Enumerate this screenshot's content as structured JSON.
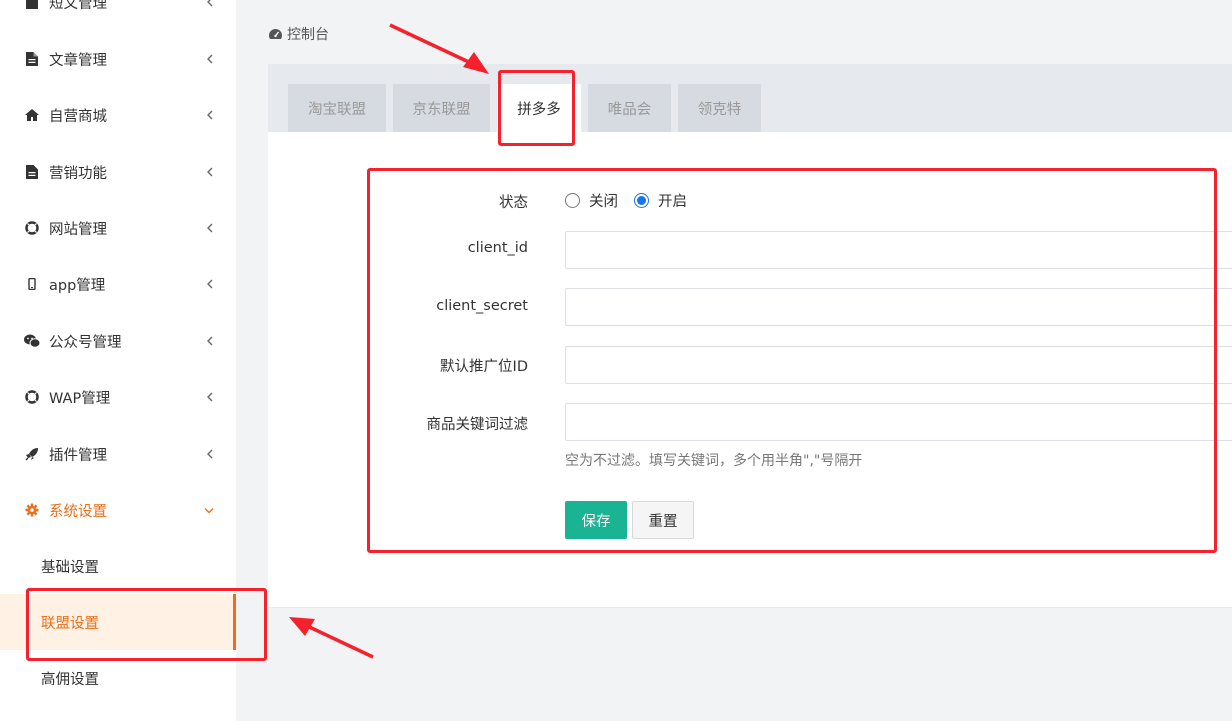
{
  "sidebar": {
    "top_partial_label": "短文管理",
    "items": [
      {
        "label": "文章管理",
        "icon": "file-icon"
      },
      {
        "label": "自营商城",
        "icon": "home-icon"
      },
      {
        "label": "营销功能",
        "icon": "file-icon"
      },
      {
        "label": "网站管理",
        "icon": "lifebuoy-icon"
      },
      {
        "label": "app管理",
        "icon": "mobile-icon"
      },
      {
        "label": "公众号管理",
        "icon": "wechat-icon"
      },
      {
        "label": "WAP管理",
        "icon": "lifebuoy-icon"
      },
      {
        "label": "插件管理",
        "icon": "rocket-icon"
      },
      {
        "label": "系统设置",
        "icon": "gear-icon"
      }
    ],
    "sub_items": [
      {
        "label": "基础设置"
      },
      {
        "label": "联盟设置"
      },
      {
        "label": "高佣设置"
      }
    ]
  },
  "breadcrumb": {
    "label": "控制台",
    "icon": "dashboard-icon"
  },
  "tabs": [
    {
      "label": "淘宝联盟"
    },
    {
      "label": "京东联盟"
    },
    {
      "label": "拼多多"
    },
    {
      "label": "唯品会"
    },
    {
      "label": "领克特"
    }
  ],
  "form": {
    "status": {
      "label": "状态",
      "options": [
        "关闭",
        "开启"
      ],
      "selected": "开启"
    },
    "client_id": {
      "label": "client_id",
      "value": ""
    },
    "client_secret": {
      "label": "client_secret",
      "value": ""
    },
    "pid": {
      "label": "默认推广位ID",
      "value": ""
    },
    "keyword_filter": {
      "label": "商品关键词过滤",
      "value": "",
      "help": "空为不过滤。填写关键词，多个用半角\",\"号隔开"
    },
    "save_label": "保存",
    "reset_label": "重置"
  },
  "colors": {
    "accent": "#e8701d",
    "primary_button": "#1ab394",
    "radio_checked": "#1a73e8",
    "annotation_red": "#f5222d"
  }
}
